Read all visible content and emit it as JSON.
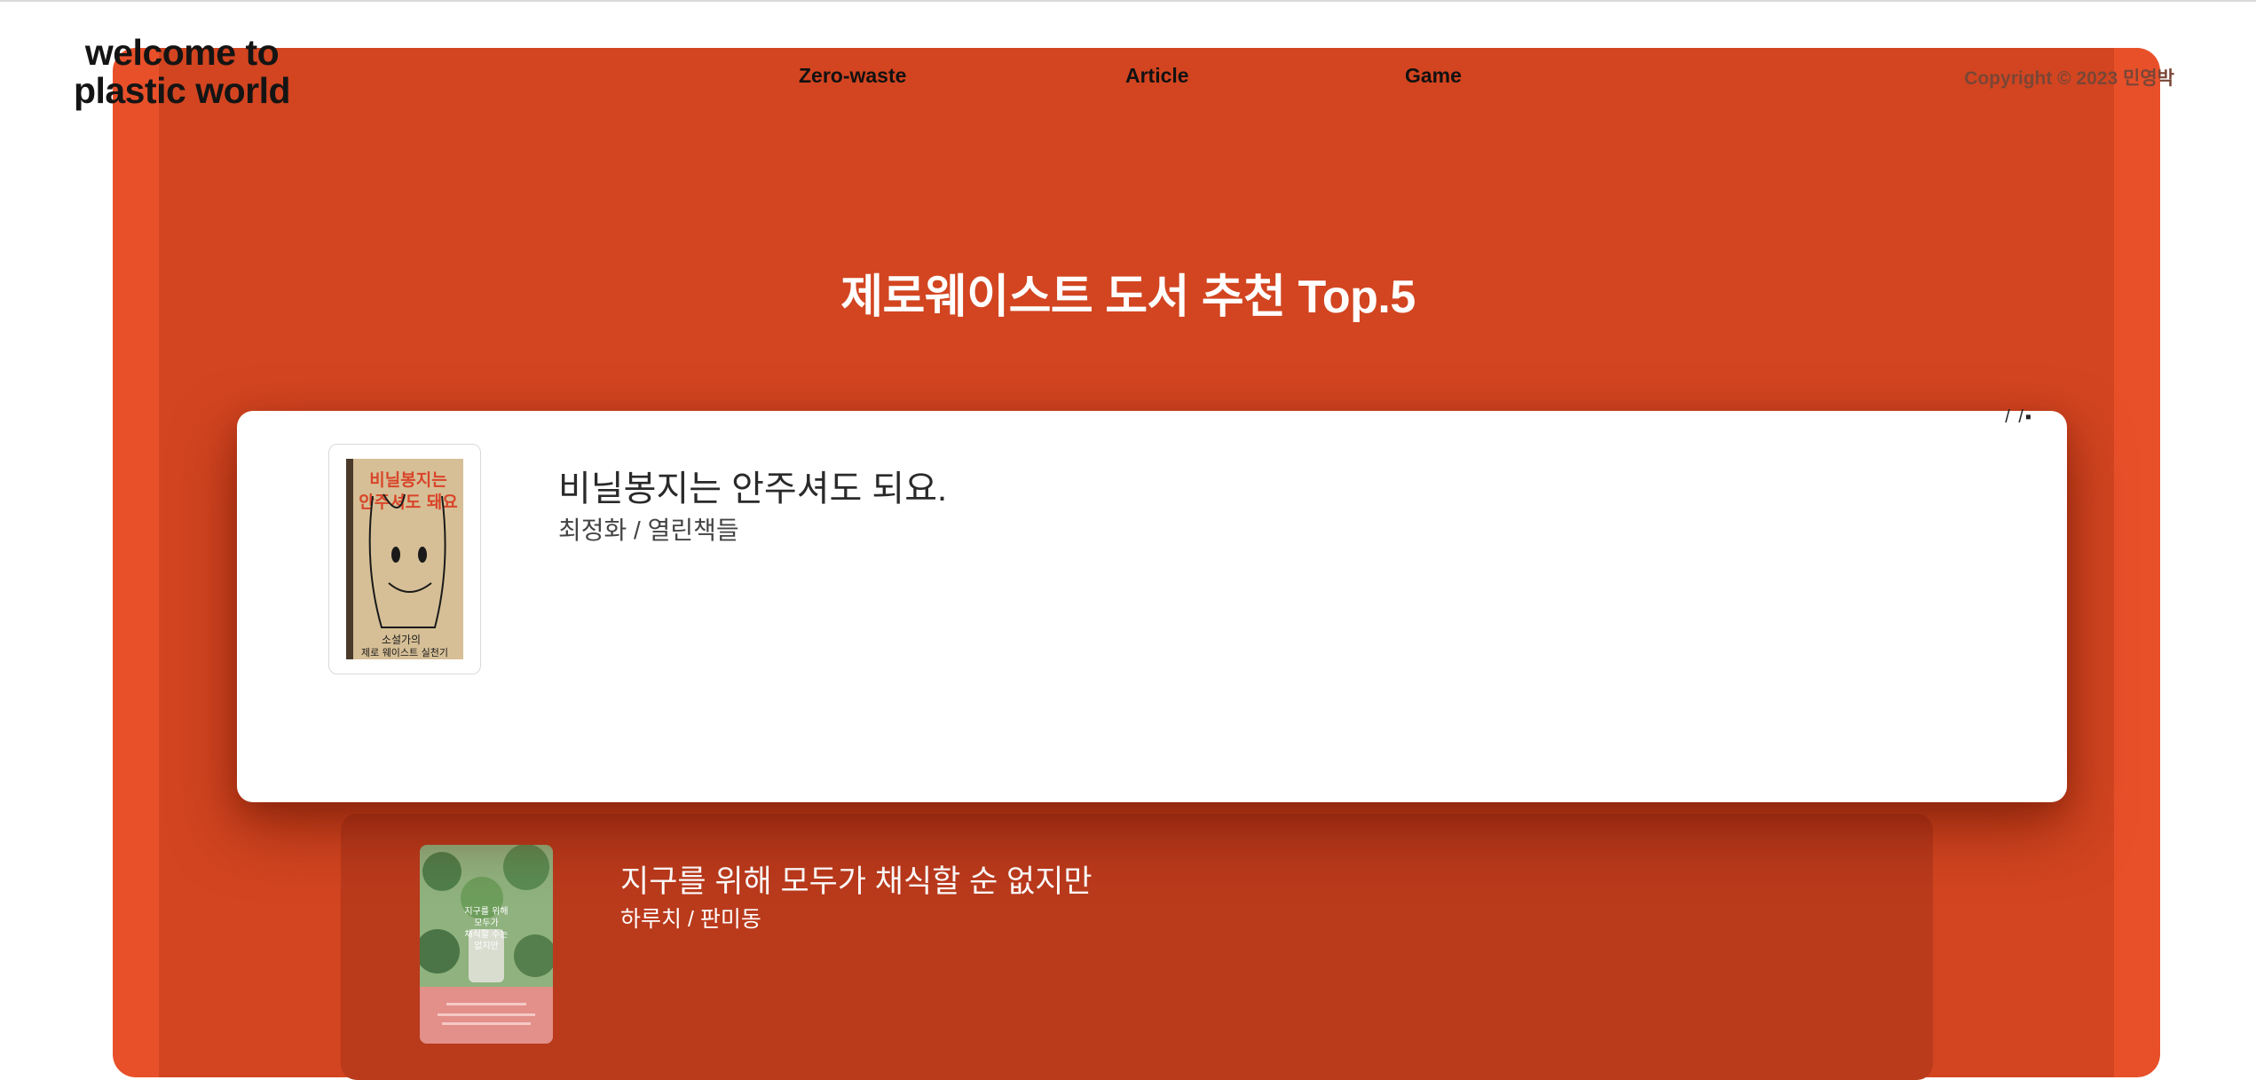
{
  "header": {
    "logo": "welcome to\nplastic world",
    "nav": [
      "Zero-waste",
      "Article",
      "Game"
    ],
    "copyright": "Copyright © 2023 민영박"
  },
  "section": {
    "title": "제로웨이스트 도서 추천 Top.5"
  },
  "books": [
    {
      "title": "비닐봉지는 안주셔도 되요.",
      "author": "최정화 / 열린책들",
      "cover_text_top": "비닐봉지는\n안주셔도 돼요",
      "cover_text_bottom": "소설가의\n제로 웨이스트 실천기",
      "cover_color": "#d6bf96"
    },
    {
      "title": "지구를 위해 모두가 채식할 순 없지만",
      "author": "하루치 / 판미동",
      "cover_text": "지구를 위해\n모두가\n채식할 수는\n없지만",
      "cover_color": "#6d9a62"
    }
  ],
  "colors": {
    "outer_frame": "#e8502a",
    "inner_frame": "#d24520",
    "card_back": "#ba3a1c"
  }
}
